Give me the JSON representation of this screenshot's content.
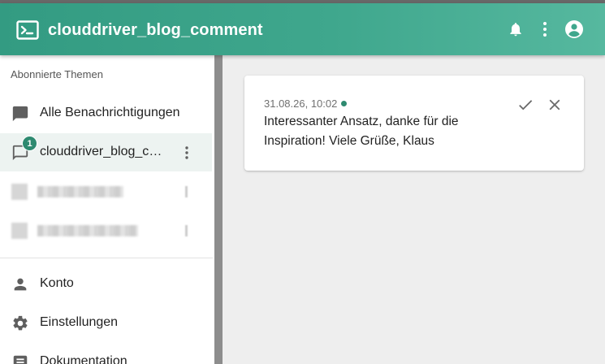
{
  "app_bar": {
    "title": "clouddriver_blog_comment",
    "logo_icon": "terminal-icon",
    "actions": [
      "bell-icon",
      "more-vert-icon",
      "account-circle-icon"
    ],
    "colors": {
      "gradient_start": "#339b82",
      "gradient_end": "#56b89f"
    }
  },
  "sidebar": {
    "section_heading": "Abonnierte Themen",
    "items": [
      {
        "label": "Alle Benachrichtigungen",
        "icon": "chat-bubble-icon"
      },
      {
        "label": "clouddriver_blog_comment",
        "icon": "chat-outline-icon",
        "badge": "1",
        "active": true
      }
    ],
    "bottom_items": [
      {
        "label": "Konto",
        "icon": "person-icon"
      },
      {
        "label": "Einstellungen",
        "icon": "gear-icon"
      },
      {
        "label": "Dokumentation",
        "icon": "document-icon"
      }
    ]
  },
  "comment": {
    "timestamp": "31.08.26, 10:02",
    "text": "Interessanter Ansatz, danke für die Inspiration! Viele Grüße, Klaus",
    "actions": [
      "check-icon",
      "close-icon"
    ],
    "status_color": "#2e8a70"
  }
}
